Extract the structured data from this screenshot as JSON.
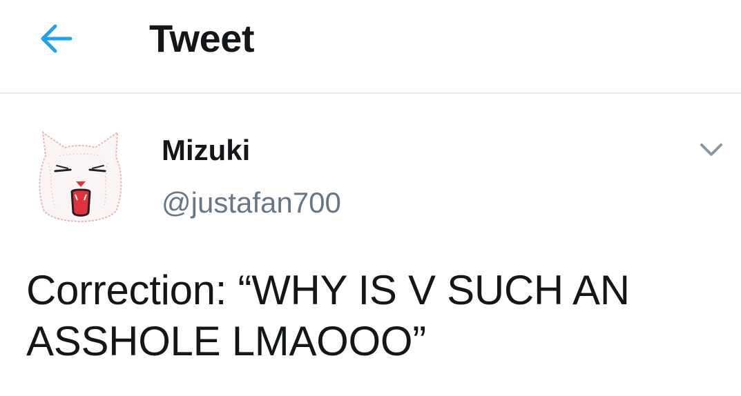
{
  "header": {
    "title": "Tweet",
    "back_icon": "arrow-left-icon",
    "accent_color": "#1da1f2"
  },
  "tweet": {
    "author": {
      "display_name": "Mizuki",
      "handle": "@justafan700",
      "avatar": "cat-avatar"
    },
    "menu_icon": "chevron-down-icon",
    "text": "Correction: “WHY IS V SUCH AN ASSHOLE LMAOOO”"
  }
}
